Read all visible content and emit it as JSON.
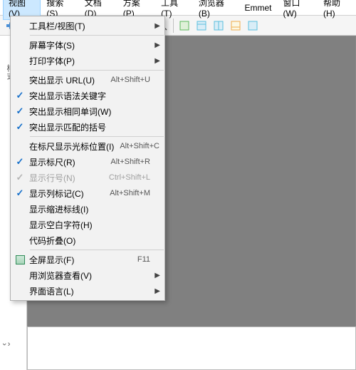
{
  "menubar": {
    "items": [
      {
        "label": "视图(V)",
        "active": true
      },
      {
        "label": "搜索(S)"
      },
      {
        "label": "文档(D)"
      },
      {
        "label": "方案(P)"
      },
      {
        "label": "工具(T)"
      },
      {
        "label": "浏览器(B)"
      },
      {
        "label": "Emmet"
      },
      {
        "label": "窗口(W)"
      },
      {
        "label": "帮助(H)"
      }
    ]
  },
  "dropdown": {
    "groups": [
      [
        {
          "label": "工具栏/视图(T)",
          "submenu": true,
          "highlighted": true
        }
      ],
      [
        {
          "label": "屏幕字体(S)",
          "submenu": true
        },
        {
          "label": "打印字体(P)",
          "submenu": true
        }
      ],
      [
        {
          "label": "突出显示 URL(U)",
          "shortcut": "Alt+Shift+U"
        },
        {
          "label": "突出显示语法关键字",
          "checked": true
        },
        {
          "label": "突出显示相同单词(W)",
          "checked": true
        },
        {
          "label": "突出显示匹配的括号",
          "checked": true
        }
      ],
      [
        {
          "label": "在标尺显示光标位置(I)",
          "shortcut": "Alt+Shift+C"
        },
        {
          "label": "显示标尺(R)",
          "shortcut": "Alt+Shift+R",
          "checked": true
        },
        {
          "label": "显示行号(N)",
          "shortcut": "Ctrl+Shift+L",
          "checked": true,
          "disabled": true
        },
        {
          "label": "显示列标记(C)",
          "shortcut": "Alt+Shift+M",
          "checked": true
        },
        {
          "label": "显示缩进标线(I)"
        },
        {
          "label": "显示空白字符(H)"
        },
        {
          "label": "代码折叠(O)"
        }
      ],
      [
        {
          "label": "全屏显示(F)",
          "shortcut": "F11",
          "icon": "fullscreen"
        },
        {
          "label": "用浏览器查看(V)",
          "submenu": true
        },
        {
          "label": "界面语言(L)",
          "submenu": true
        }
      ]
    ]
  },
  "toolbar_icons": [
    "redo",
    "sep",
    "cut",
    "copy",
    "paste",
    "sep",
    "undo2",
    "redo2",
    "font-color",
    "highlight",
    "sep",
    "search",
    "sep",
    "panel1",
    "panel2",
    "panel3",
    "panel4",
    "panel5"
  ],
  "left_strip": {
    "label": "样式"
  }
}
